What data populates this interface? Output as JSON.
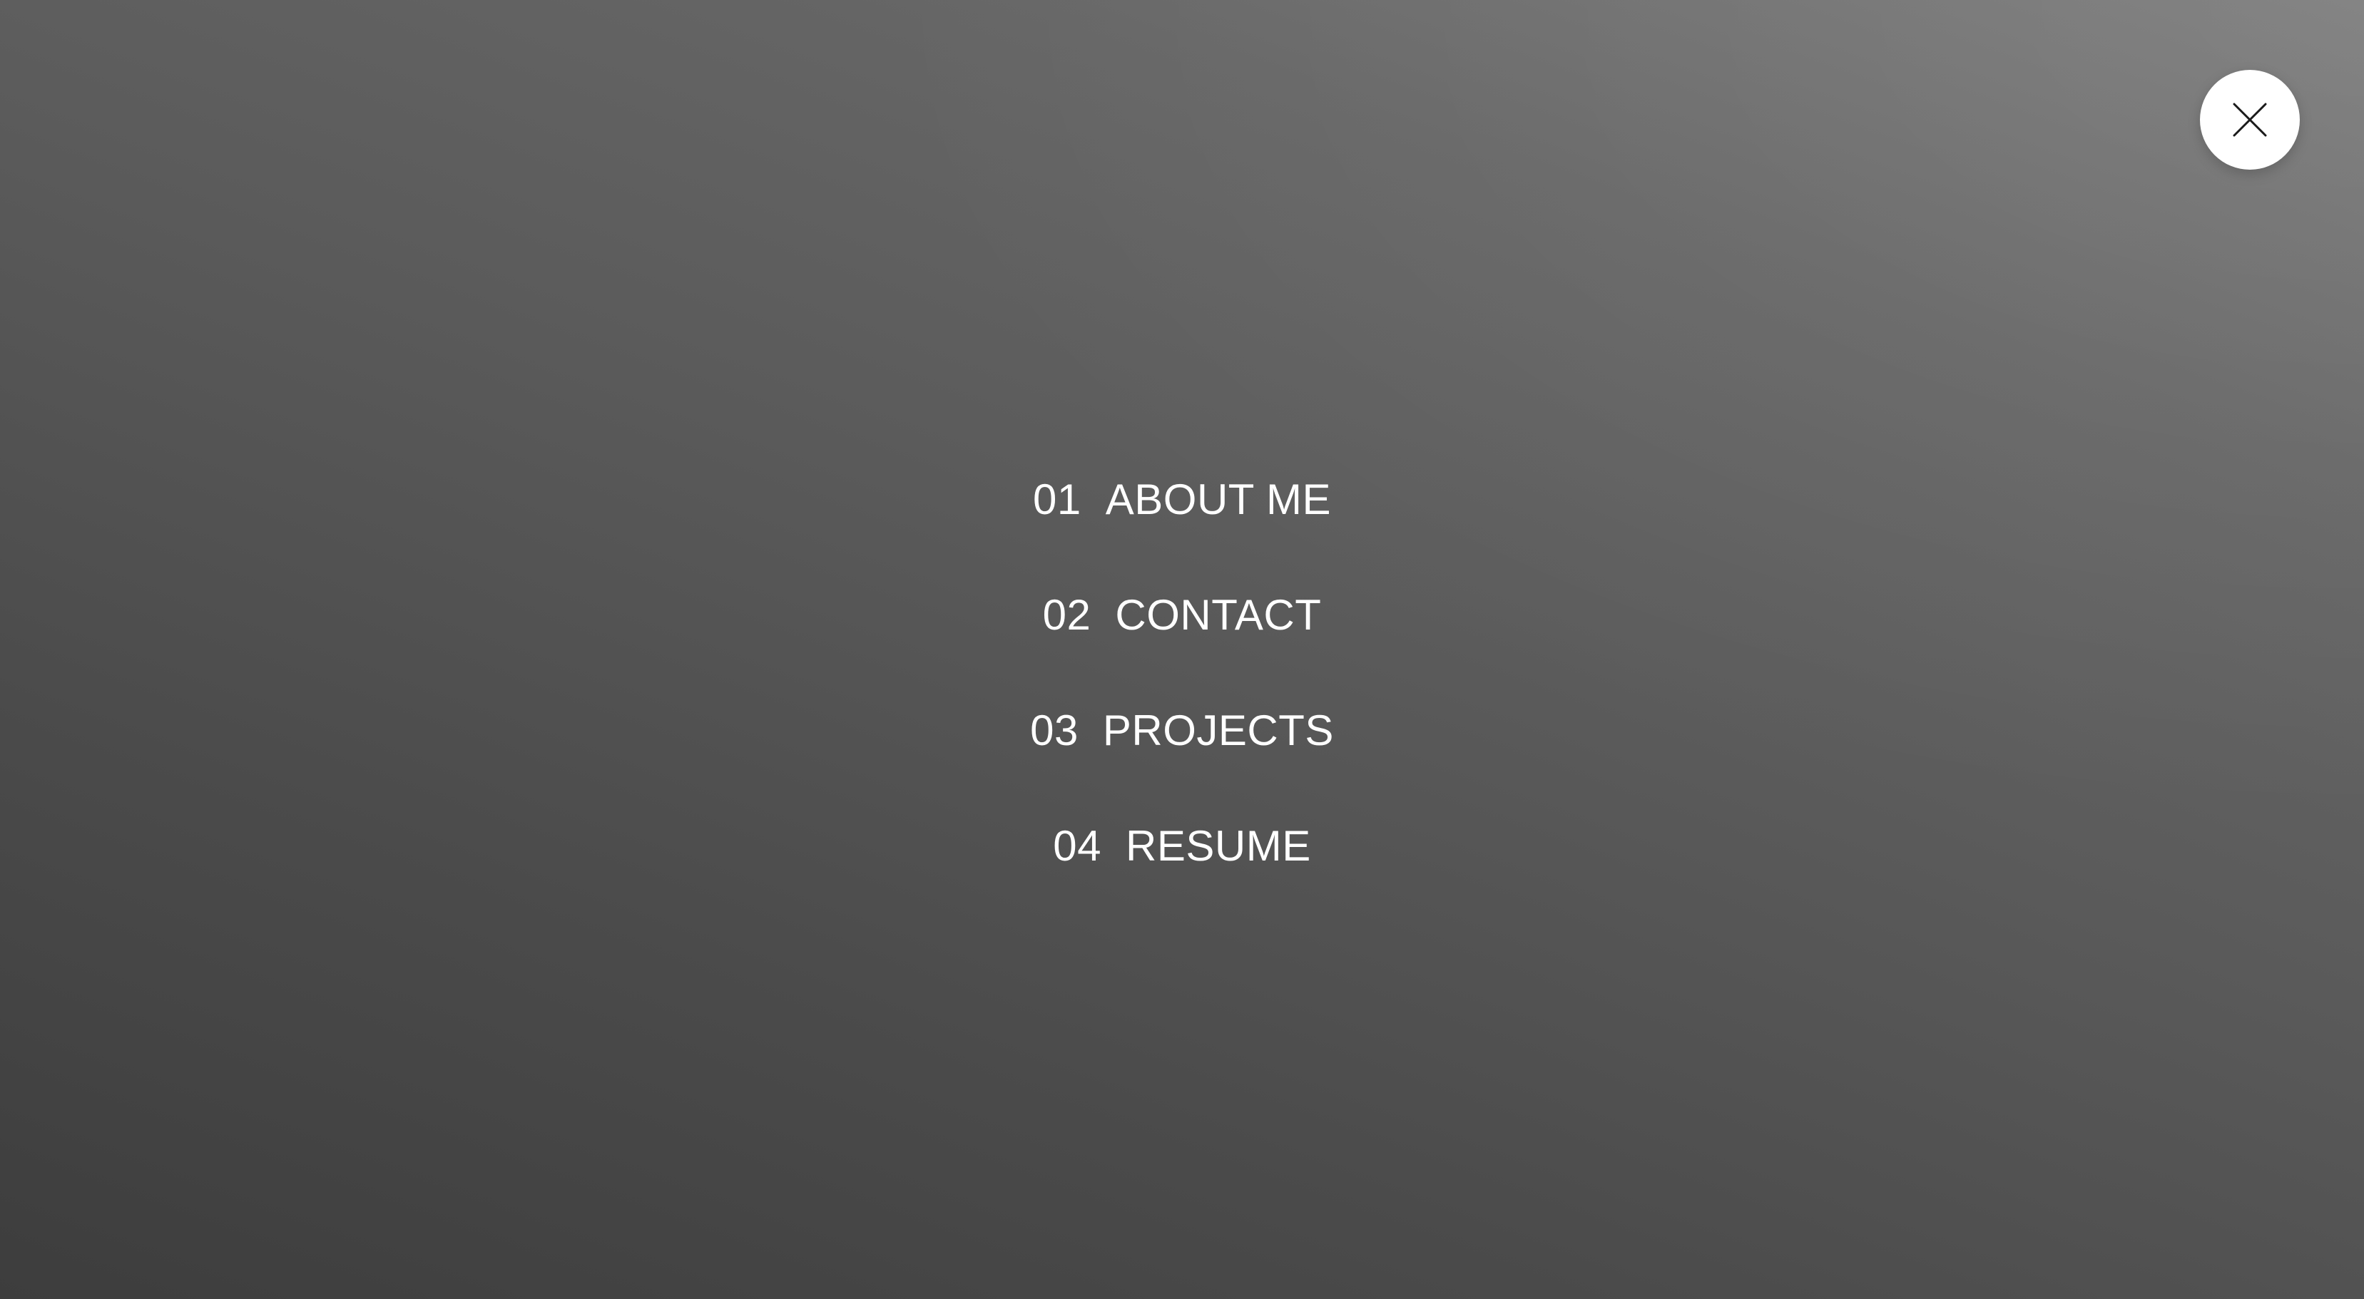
{
  "close_button": {
    "icon": "close-icon"
  },
  "menu": {
    "items": [
      {
        "number": "01",
        "label": "ABOUT ME"
      },
      {
        "number": "02",
        "label": "CONTACT"
      },
      {
        "number": "03",
        "label": "PROJECTS"
      },
      {
        "number": "04",
        "label": "RESUME"
      }
    ]
  },
  "colors": {
    "text": "#ffffff",
    "close_button_bg": "#ffffff",
    "close_icon": "#1a1a1a",
    "background_dark": "#3d3d3d",
    "background_light": "#7a7a7a"
  }
}
